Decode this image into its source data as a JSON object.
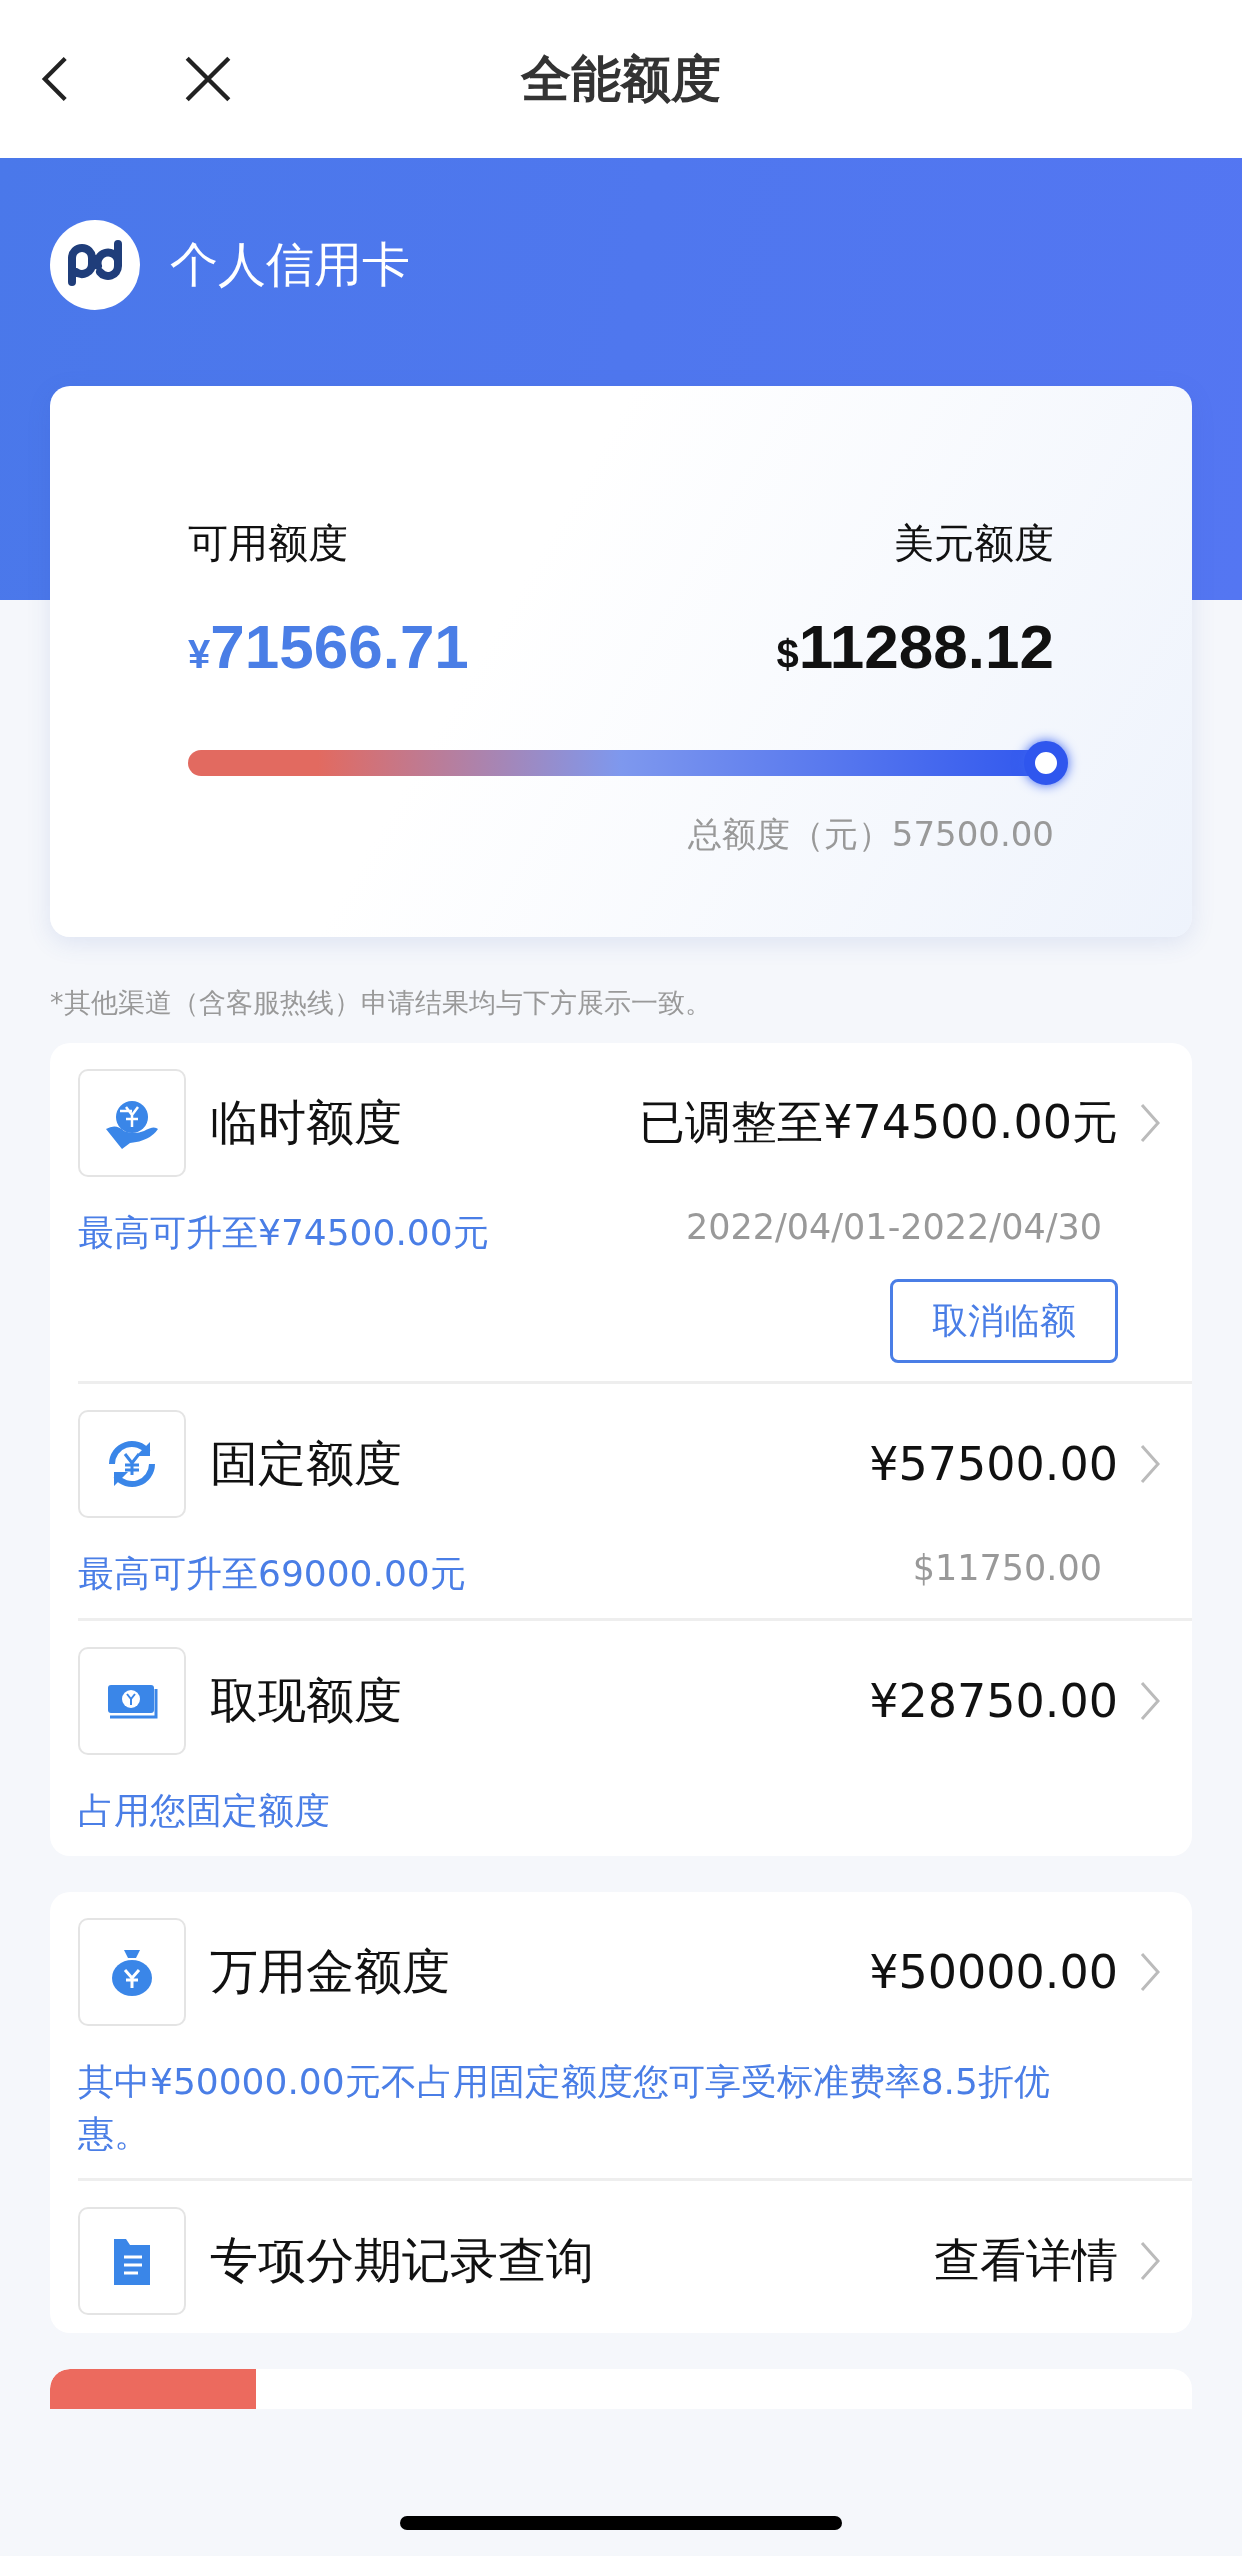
{
  "nav": {
    "title": "全能额度"
  },
  "card": {
    "name": "个人信用卡",
    "available_label": "可用额度",
    "available_currency": "¥",
    "available_amount": "71566.71",
    "usd_label": "美元额度",
    "usd_currency": "$",
    "usd_amount": "11288.12",
    "level": 1,
    "total": "总额度（元）57500.00"
  },
  "note": "*其他渠道（含客服热线）申请结果均与下方展示一致。",
  "sections": [
    [
      {
        "kind": "coin-hand",
        "title": "临时额度",
        "value": "已调整至¥74500.00元",
        "subtitle": "最高可升至¥74500.00元",
        "detail": "2022/04/01-2022/04/30",
        "button": "取消临额"
      },
      {
        "kind": "yen-refresh",
        "title": "固定额度",
        "value": "¥57500.00",
        "subtitle": "最高可升至69000.00元",
        "detail": "$11750.00"
      },
      {
        "kind": "banknote",
        "title": "取现额度",
        "value": "¥28750.00",
        "subtitle": "占用您固定额度"
      }
    ],
    [
      {
        "kind": "money-bag",
        "title": "万用金额度",
        "value": "¥50000.00",
        "subtitle": "其中¥50000.00元不占用固定额度您可享受标准费率8.5折优惠。"
      },
      {
        "kind": "document",
        "title": "专项分期记录查询",
        "value": "查看详情"
      }
    ]
  ]
}
